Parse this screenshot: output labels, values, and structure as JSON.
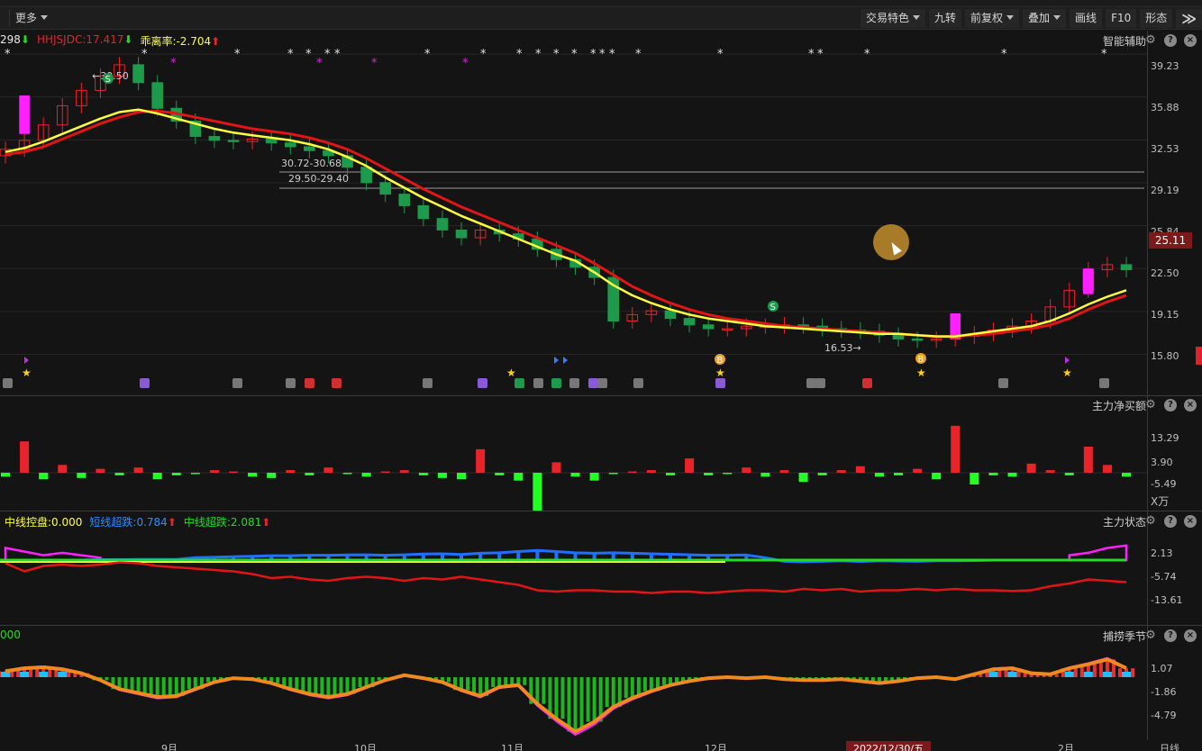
{
  "toolbar": {
    "more": "更多",
    "buttons": [
      "交易特色",
      "九转",
      "前复权",
      "叠加",
      "画线",
      "F10",
      "形态"
    ],
    "dropdown_flags": [
      true,
      false,
      true,
      true,
      false,
      false,
      false
    ]
  },
  "colors": {
    "up": "#e8232a",
    "down": "#1d9a4b",
    "ma_fast": "#ffff40",
    "ma_slow": "#e01515",
    "magenta": "#ff20ff",
    "green_bar": "#22ff22",
    "blue": "#2070ff",
    "orange": "#f08a20"
  },
  "pane1": {
    "title": "智能辅助",
    "legend": [
      {
        "text": "298",
        "color": "#e8e8e8",
        "arrow": "down"
      },
      {
        "text": "HHJSJDC:17.417",
        "color": "#e8232a",
        "arrow": "down"
      },
      {
        "text": "乖离率:-2.704",
        "color": "#ffff40",
        "arrow": "up"
      }
    ],
    "y_labels": [
      "39.23",
      "35.88",
      "32.53",
      "29.19",
      "25.84",
      "22.50",
      "19.15",
      "15.80"
    ],
    "current_price": "25.11",
    "annotations": {
      "high": "39.50",
      "low": "16.53",
      "zone1": "30.72-30.68",
      "zone2": "29.50-29.40"
    },
    "signal_letters": [
      "S",
      "S",
      "B",
      "B"
    ]
  },
  "pane2": {
    "title": "主力净买额",
    "y_labels": [
      "13.29",
      "3.90",
      "-5.49"
    ],
    "unit": "X万"
  },
  "pane3": {
    "title": "主力状态",
    "legend": [
      {
        "text": "中线控盘:0.000",
        "color": "#ffff40",
        "arrow": ""
      },
      {
        "text": "短线超跌:0.784",
        "color": "#2f8cff",
        "arrow": "up"
      },
      {
        "text": "中线超跌:2.081",
        "color": "#22dd22",
        "arrow": "up"
      }
    ],
    "y_labels": [
      "2.13",
      "-5.74",
      "-13.61"
    ]
  },
  "pane4": {
    "title": "捕捞季节",
    "legend": [
      {
        "text": "000",
        "color": "#22dd22",
        "arrow": ""
      }
    ],
    "y_labels": [
      "1.07",
      "-1.86",
      "-4.79"
    ]
  },
  "x_axis": {
    "labels": [
      "9月",
      "10月",
      "11月",
      "12月",
      "2022/12/30/五",
      "2月"
    ],
    "right_label": "日线"
  },
  "chart_data": [
    {
      "type": "candlestick",
      "title": "智能辅助",
      "ylim": [
        14.5,
        40.5
      ],
      "ma_fast": [
        31.6,
        31.9,
        32.4,
        33.0,
        33.6,
        34.2,
        34.7,
        34.9,
        34.6,
        34.2,
        33.8,
        33.4,
        33.1,
        32.9,
        32.7,
        32.5,
        32.2,
        31.8,
        31.2,
        30.5,
        29.6,
        28.8,
        28.0,
        27.3,
        26.6,
        26.0,
        25.4,
        24.8,
        24.2,
        23.6,
        23.1,
        22.2,
        21.2,
        20.4,
        19.8,
        19.3,
        18.9,
        18.6,
        18.4,
        18.2,
        18.0,
        17.9,
        17.8,
        17.7,
        17.6,
        17.5,
        17.4,
        17.4,
        17.3,
        17.2,
        17.2,
        17.4,
        17.6,
        17.8,
        18.0,
        18.4,
        19.0,
        19.7,
        20.3,
        20.8
      ],
      "ma_slow": [
        31.4,
        31.6,
        32.0,
        32.6,
        33.2,
        33.8,
        34.3,
        34.7,
        34.8,
        34.6,
        34.3,
        34.0,
        33.7,
        33.4,
        33.2,
        33.0,
        32.7,
        32.3,
        31.8,
        31.1,
        30.3,
        29.5,
        28.7,
        28.0,
        27.3,
        26.7,
        26.1,
        25.5,
        24.9,
        24.3,
        23.7,
        22.9,
        22.0,
        21.1,
        20.4,
        19.8,
        19.3,
        18.9,
        18.6,
        18.4,
        18.2,
        18.0,
        17.9,
        17.8,
        17.7,
        17.6,
        17.5,
        17.4,
        17.3,
        17.2,
        17.2,
        17.3,
        17.4,
        17.6,
        17.8,
        18.1,
        18.6,
        19.3,
        19.9,
        20.4
      ],
      "closes": [
        31.8,
        32.5,
        33.7,
        35.2,
        36.4,
        37.5,
        38.4,
        37.0,
        35.0,
        34.0,
        32.8,
        32.5,
        32.4,
        32.6,
        32.3,
        32.0,
        31.7,
        31.3,
        30.4,
        29.2,
        28.3,
        27.4,
        26.4,
        25.5,
        24.9,
        25.5,
        25.2,
        24.8,
        24.0,
        23.2,
        22.6,
        21.8,
        18.4,
        18.9,
        19.2,
        18.6,
        18.1,
        17.8,
        17.8,
        18.0,
        18.0,
        18.1,
        18.0,
        17.8,
        17.7,
        17.6,
        17.3,
        17.0,
        16.9,
        17.0,
        17.2,
        17.4,
        17.7,
        18.0,
        18.4,
        19.5,
        20.8,
        22.4,
        22.8,
        22.4
      ],
      "net_buy": [
        -1.5,
        12.0,
        -2.5,
        3.0,
        -2.0,
        1.5,
        -1.0,
        2.0,
        -2.5,
        -1.0,
        -0.5,
        1.0,
        0.5,
        -1.5,
        -2.0,
        1.0,
        -1.0,
        2.0,
        -0.5,
        -1.5,
        0.5,
        1.0,
        -1.0,
        -2.0,
        -2.5,
        9.0,
        -1.0,
        -3.0,
        -16.0,
        4.0,
        -1.5,
        -3.0,
        -0.5,
        0.5,
        1.0,
        -1.0,
        5.5,
        -1.0,
        -0.5,
        2.0,
        -1.5,
        1.0,
        -3.5,
        -1.0,
        1.0,
        2.5,
        -1.5,
        -1.0,
        1.5,
        -2.5,
        18.0,
        -4.5,
        -1.0,
        -1.5,
        3.5,
        1.0,
        -1.0,
        10.0,
        3.0,
        -1.5
      ],
      "main_state": [
        -6.5,
        -9.5,
        -7.5,
        -7.0,
        -7.5,
        -7.0,
        -6.2,
        -6.5,
        -7.5,
        -8.0,
        -8.5,
        -9.0,
        -9.5,
        -10.5,
        -12.0,
        -11.5,
        -12.5,
        -13.0,
        -12.0,
        -11.5,
        -12.0,
        -13.0,
        -12.0,
        -12.5,
        -11.5,
        -12.5,
        -13.5,
        -14.5,
        -16.5,
        -17.0,
        -16.5,
        -16.5,
        -17.0,
        -17.0,
        -17.5,
        -17.0,
        -17.0,
        -17.5,
        -17.0,
        -16.5,
        -16.5,
        -17.0,
        -16.0,
        -16.5,
        -16.0,
        -17.0,
        -16.5,
        -16.5,
        -16.0,
        -16.5,
        -16.0,
        -16.5,
        -16.5,
        -16.8,
        -16.5,
        -15.0,
        -14.0,
        -12.5,
        -13.0,
        -13.5
      ],
      "short_oversold": [
        0.0,
        0.0,
        0.0,
        0.0,
        0.0,
        0.2,
        0.2,
        0.3,
        0.3,
        0.3,
        1.0,
        1.2,
        1.4,
        1.6,
        1.8,
        1.8,
        2.0,
        2.0,
        2.1,
        2.2,
        2.0,
        2.2,
        2.5,
        2.6,
        2.3,
        2.8,
        3.0,
        3.5,
        4.0,
        3.5,
        3.0,
        2.8,
        3.0,
        2.8,
        2.6,
        2.4,
        2.2,
        2.0,
        2.0,
        2.1,
        1.0,
        -0.5,
        -0.7,
        -0.5,
        -0.3,
        -0.6,
        -0.3,
        -0.4,
        -0.5,
        -0.3,
        -0.3,
        -0.2,
        0.0,
        0.0,
        0.0,
        0.0,
        0.0,
        0.0,
        0.0,
        0.0
      ],
      "mid_overshoot": [
        5.0,
        3.5,
        2.0,
        3.0,
        2.0,
        1.0,
        0.0,
        0.0,
        0.0,
        0.0,
        0.0,
        0.0,
        0.0,
        0.0,
        0.0,
        0.0,
        0.0,
        0.0,
        0.0,
        0.0,
        0.0,
        0.0,
        0.0,
        0.0,
        0.0,
        0.0,
        0.0,
        0.0,
        0.0,
        0.0,
        0.0,
        0.0,
        0.0,
        0.0,
        0.0,
        0.0,
        0.0,
        0.0,
        0.0,
        0.0,
        0.0,
        0.0,
        0.0,
        0.0,
        0.0,
        0.0,
        0.0,
        0.0,
        0.0,
        0.0,
        0.0,
        0.0,
        0.0,
        0.0,
        0.0,
        0.0,
        2.0,
        3.0,
        5.0,
        6.0
      ],
      "oscillator": [
        0.6,
        0.9,
        1.0,
        0.8,
        0.4,
        -0.3,
        -1.2,
        -1.6,
        -2.0,
        -1.9,
        -1.2,
        -0.5,
        -0.1,
        -0.2,
        -0.6,
        -1.2,
        -1.7,
        -2.0,
        -1.7,
        -1.0,
        -0.3,
        0.2,
        -0.1,
        -0.5,
        -1.3,
        -1.9,
        -1.0,
        -0.8,
        -2.7,
        -4.2,
        -5.5,
        -4.5,
        -3.0,
        -2.1,
        -1.4,
        -0.8,
        -0.4,
        -0.1,
        0.0,
        -0.1,
        0.0,
        -0.2,
        -0.3,
        -0.3,
        -0.2,
        -0.4,
        -0.6,
        -0.4,
        -0.1,
        0.0,
        -0.2,
        0.3,
        0.8,
        0.9,
        0.4,
        0.3,
        0.9,
        1.3,
        1.8,
        0.9
      ]
    }
  ]
}
